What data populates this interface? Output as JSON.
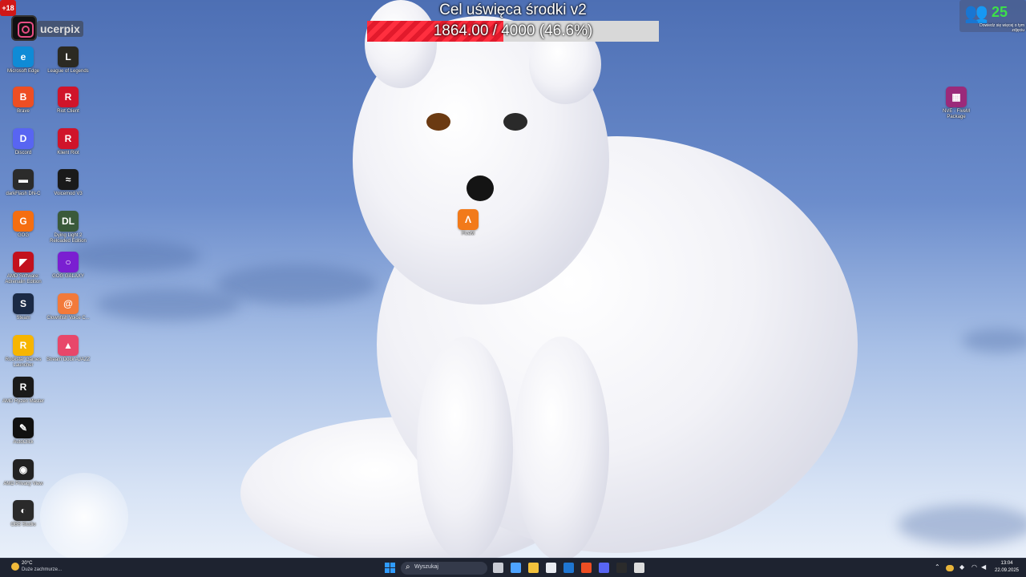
{
  "overlay": {
    "goal_title": "Cel uświęca środki v2",
    "goal_text": "1864.00 / 4000 (46.6%)",
    "goal_current": 1864.0,
    "goal_target": 4000,
    "goal_fraction": 0.466,
    "age_badge": "+18",
    "handle": "ucerpix"
  },
  "top_right": {
    "viewer_count": "25",
    "note": "Dowiedz się więcej o tym zdjęciu"
  },
  "desktop_icons": [
    {
      "name": "microsoft-edge",
      "label": "Microsoft Edge",
      "color": "#0f8bd6",
      "glyph": "e"
    },
    {
      "name": "league-of-legends",
      "label": "League of Legends",
      "color": "#2b2a22",
      "glyph": "L"
    },
    {
      "name": "brave",
      "label": "Brave",
      "color": "#ee4e23",
      "glyph": "B"
    },
    {
      "name": "riot-client",
      "label": "Riot Client",
      "color": "#d0142a",
      "glyph": "R"
    },
    {
      "name": "discord",
      "label": "Discord",
      "color": "#5865f2",
      "glyph": "D"
    },
    {
      "name": "klient-riot",
      "label": "Klient Riot",
      "color": "#d0142a",
      "glyph": "R"
    },
    {
      "name": "darkflash",
      "label": "darkFlash DN-C",
      "color": "#2b2b2b",
      "glyph": "▬"
    },
    {
      "name": "voicemod",
      "label": "Voicemod V3",
      "color": "#1a1a1a",
      "glyph": "≈"
    },
    {
      "name": "gog",
      "label": "GOG",
      "color": "#f56e11",
      "glyph": "G"
    },
    {
      "name": "dying-light",
      "label": "Dying Light 2 Reloaded Edition",
      "color": "#3a5a3a",
      "glyph": "DL"
    },
    {
      "name": "amd-software",
      "label": "AMD Software: Adrenalin Edition",
      "color": "#c3111d",
      "glyph": "◤"
    },
    {
      "name": "gog-galaxy",
      "label": "GOG GALAXY",
      "color": "#7a1fd1",
      "glyph": "○"
    },
    {
      "name": "steam",
      "label": "Steam",
      "color": "#1b2a45",
      "glyph": "S"
    },
    {
      "name": "clownfish",
      "label": "Clownfish Voice C...",
      "color": "#f27a3a",
      "glyph": "@"
    },
    {
      "name": "rockstar",
      "label": "Rockstar Games Launcher",
      "color": "#f7b500",
      "glyph": "R"
    },
    {
      "name": "stream-dock",
      "label": "Stream Dock AJAZZ",
      "color": "#e8476a",
      "glyph": "▲"
    },
    {
      "name": "ryzen-master",
      "label": "AMD Ryzen Master",
      "color": "#1a1a1a",
      "glyph": "R"
    },
    {
      "name": "autoclick",
      "label": "AutoClick",
      "color": "#111111",
      "glyph": "✎"
    },
    {
      "name": "amd-privacy-view",
      "label": "AMD Privacy View",
      "color": "#222222",
      "glyph": "◉"
    },
    {
      "name": "obs-studio",
      "label": "OBS Studio",
      "color": "#2a2a2a",
      "glyph": "◐"
    }
  ],
  "center_icon": {
    "label": "FiveM",
    "color": "#f27a1a",
    "glyph": "Λ"
  },
  "right_icon": {
    "label": "NVE - FiveM Package",
    "color": "#9b2a7a",
    "glyph": "▦"
  },
  "taskbar": {
    "weather_temp": "20°C",
    "weather_desc": "Duże zachmurze...",
    "search_placeholder": "Wyszukaj",
    "apps": [
      {
        "name": "task-view",
        "color": "#c9ccd4"
      },
      {
        "name": "copilot",
        "color": "#4da3ff"
      },
      {
        "name": "file-explorer",
        "color": "#f3c23c"
      },
      {
        "name": "microsoft-store",
        "color": "#e9ecf2"
      },
      {
        "name": "outlook",
        "color": "#1f76d2"
      },
      {
        "name": "brave",
        "color": "#ee4e23"
      },
      {
        "name": "discord",
        "color": "#5865f2"
      },
      {
        "name": "terminal",
        "color": "#2b2b2b"
      },
      {
        "name": "obs",
        "color": "#dcdcdc"
      }
    ],
    "time": "13:04",
    "date": "22.09.2025"
  }
}
